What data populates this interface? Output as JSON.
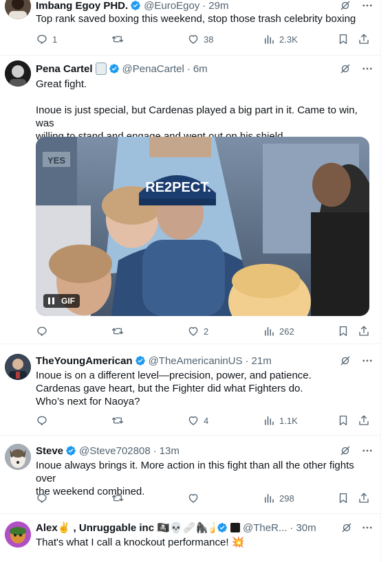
{
  "tweets": [
    {
      "name": "Imbang Egoy PHD.",
      "handle": "@EuroEgoy",
      "time": "29m",
      "text": "Top rank saved boxing this weekend, stop those trash celebrity boxing",
      "replies": "1",
      "retweets": "",
      "likes": "38",
      "views": "2.3K"
    },
    {
      "name": "Pena Cartel",
      "handle": "@PenaCartel",
      "time": "6m",
      "text_lines": [
        "Great fight.",
        "",
        "Inoue is just special, but Cardenas played a big part in it. Came to win, was",
        "willing to stand and engage and went out on his shield"
      ],
      "media": {
        "badge": "GIF",
        "cap_text": "RE2PECT.",
        "sign_text": "YES"
      },
      "replies": "",
      "retweets": "",
      "likes": "2",
      "views": "262"
    },
    {
      "name": "TheYoungAmerican",
      "handle": "@TheAmericaninUS",
      "time": "21m",
      "text_lines": [
        "Inoue is on a different level—precision, power, and patience.",
        "Cardenas gave heart, but the Fighter  did what Fighters do.",
        "Who’s next for Naoya?"
      ],
      "replies": "",
      "retweets": "",
      "likes": "4",
      "views": "1.1K"
    },
    {
      "name": "Steve",
      "handle": "@Steve702808",
      "time": "13m",
      "text_lines": [
        "Inoue always brings it. More action in this fight than all the other fights over",
        "the weekend combined."
      ],
      "replies": "",
      "retweets": "",
      "likes": "",
      "views": "298"
    },
    {
      "name": "Alex✌️ , Unruggable inc 🏴‍☠️💀🩹🦍🍌🦣...",
      "handle": "@TheR...",
      "time": "30m",
      "text": "That's what I call a knockout performance! 💥"
    }
  ],
  "colors": {
    "verified": "#1d9bf0",
    "muted": "#536471",
    "text": "#0f1419",
    "divider": "#eff3f4"
  },
  "icons": [
    "verified-badge-icon",
    "grok-icon",
    "more-icon",
    "reply-icon",
    "retweet-icon",
    "like-icon",
    "views-icon",
    "bookmark-icon",
    "share-icon"
  ]
}
